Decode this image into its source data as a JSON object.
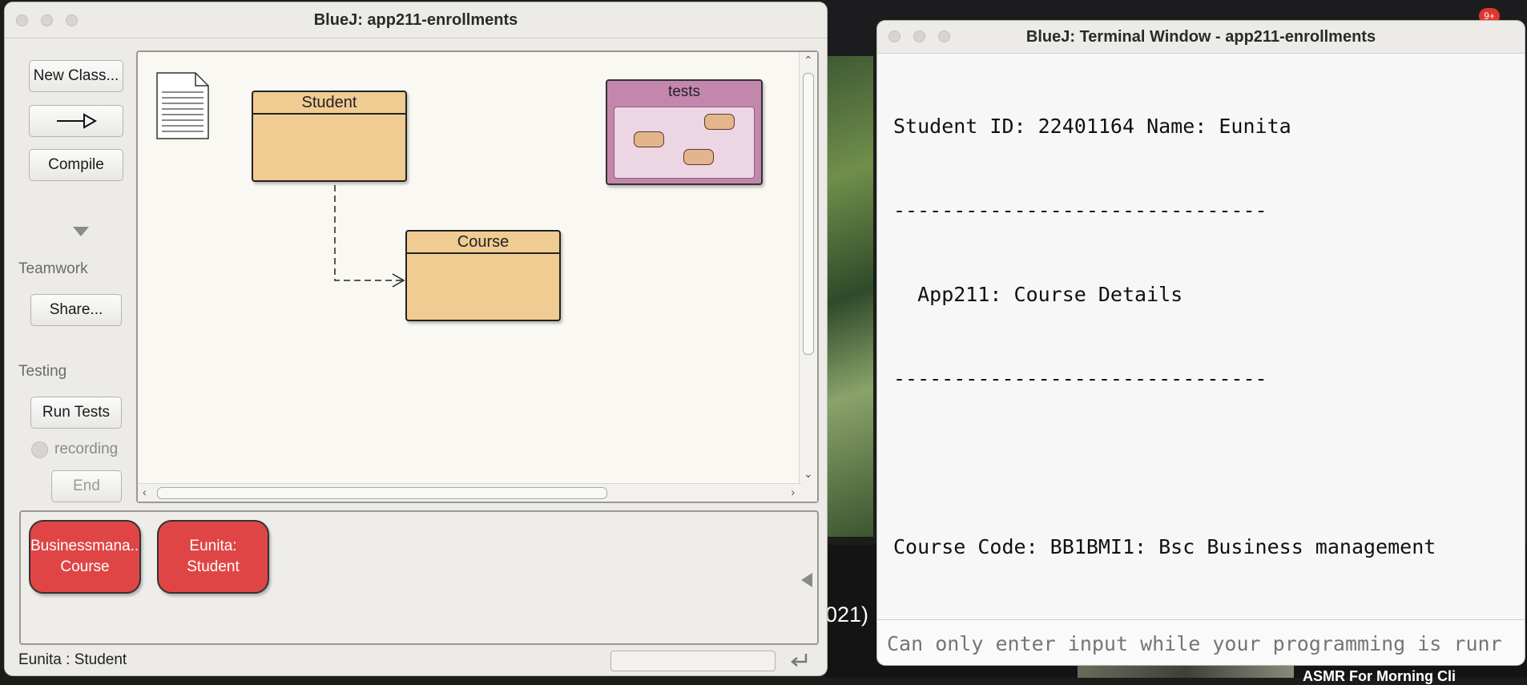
{
  "background": {
    "year_fragment": "021)",
    "caption_fragment": "ASMR For Morning Cli",
    "badge": "9+"
  },
  "main_window": {
    "title": "BlueJ:  app211-enrollments",
    "sidebar": {
      "new_class": "New Class...",
      "new_arrow": "⟶▷",
      "compile": "Compile",
      "teamwork_label": "Teamwork",
      "share": "Share...",
      "testing_label": "Testing",
      "run_tests": "Run Tests",
      "recording": "recording",
      "end": "End"
    },
    "diagram": {
      "classes": [
        "Student",
        "Course"
      ],
      "package": "tests"
    },
    "object_bench": [
      {
        "name": "Businessmana...",
        "type": "Course"
      },
      {
        "name": "Eunita:",
        "type": "Student"
      }
    ],
    "status": "Eunita : Student"
  },
  "terminal": {
    "title": "BlueJ: Terminal Window - app211-enrollments",
    "lines": [
      "Student ID: 22401164 Name: Eunita",
      "-------------------------------",
      "  App211: Course Details",
      "-------------------------------",
      "",
      "Course Code: BB1BMI1: Bsc Business management"
    ],
    "input_placeholder": "Can only enter input while your programming is runr"
  }
}
